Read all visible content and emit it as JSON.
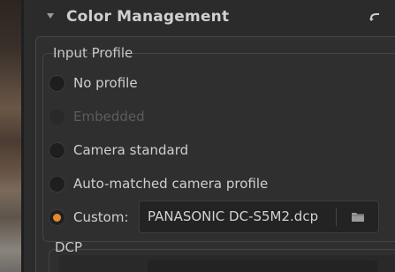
{
  "panel": {
    "title": "Color Management",
    "input_profile": {
      "group_label": "Input Profile",
      "options": [
        {
          "label": "No profile",
          "state": "unchecked"
        },
        {
          "label": "Embedded",
          "state": "disabled"
        },
        {
          "label": "Camera standard",
          "state": "unchecked"
        },
        {
          "label": "Auto-matched camera profile",
          "state": "unchecked"
        },
        {
          "label": "Custom:",
          "state": "checked"
        }
      ],
      "custom_file": "PANASONIC DC-S5M2.dcp"
    },
    "dcp": {
      "group_label": "DCP"
    }
  },
  "icons": {
    "collapse": "chevron-down-icon",
    "reset": "reset-arrow-icon",
    "browse": "folder-icon"
  },
  "colors": {
    "accent": "#e48a2c",
    "background": "#2b2b2b",
    "text": "#cfcfcf",
    "disabled_text": "#5c5c5c"
  }
}
